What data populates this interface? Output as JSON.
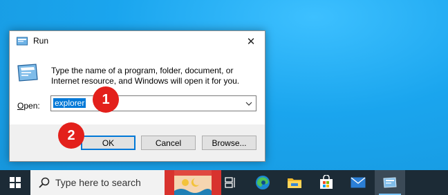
{
  "dialog": {
    "title": "Run",
    "description": "Type the name of a program, folder, document, or Internet resource, and Windows will open it for you.",
    "open_label_prefix": "",
    "open_label_underlined": "O",
    "open_label_rest": "pen:",
    "input_value": "explorer",
    "ok_label": "OK",
    "cancel_label": "Cancel",
    "browse_label": "Browse...",
    "close_glyph": "✕",
    "dropdown_glyph": "⌄"
  },
  "markers": {
    "one": "1",
    "two": "2"
  },
  "taskbar": {
    "search_placeholder": "Type here to search",
    "icons": [
      "windows-start-icon",
      "search-icon",
      "task-view-icon",
      "edge-icon",
      "file-explorer-icon",
      "microsoft-store-icon",
      "mail-icon",
      "run-icon"
    ]
  },
  "colors": {
    "accent": "#0078d7",
    "marker": "#e3201b",
    "taskbar": "#1c2b36",
    "desktop": "#1aa5ee"
  }
}
